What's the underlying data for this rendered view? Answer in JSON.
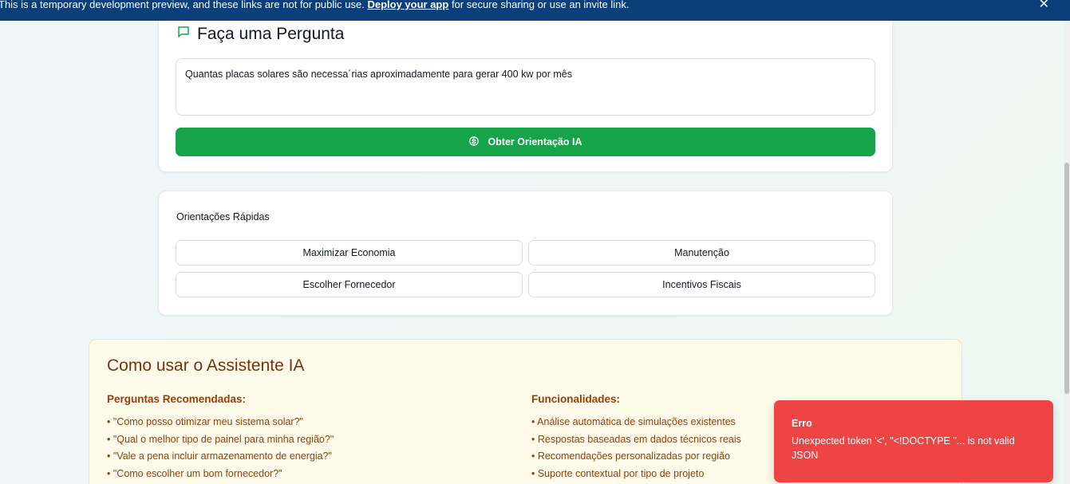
{
  "banner": {
    "text_before": "This is a temporary development preview, and these links are not for public use. ",
    "link_label": "Deploy your app",
    "text_after": " for secure sharing or use an invite link.",
    "close_glyph": "✕"
  },
  "ask": {
    "title": "Faça uma Pergunta",
    "question_value": "Quantas placas solares são necessa´rias aproximadamente para gerar 400 kw por mês",
    "button_label": "Obter Orientação IA",
    "accent": "#16a34a"
  },
  "quick": {
    "title": "Orientações Rápidas",
    "buttons": [
      "Maximizar Economia",
      "Manutenção",
      "Escolher Fornecedor",
      "Incentivos Fiscais"
    ]
  },
  "help": {
    "title": "Como usar o Assistente IA",
    "recommended": {
      "heading": "Perguntas Recomendadas:",
      "items": [
        "• \"Como posso otimizar meu sistema solar?\"",
        "• \"Qual o melhor tipo de painel para minha região?\"",
        "• \"Vale a pena incluir armazenamento de energia?\"",
        "• \"Como escolher um bom fornecedor?\""
      ]
    },
    "features": {
      "heading": "Funcionalidades:",
      "items": [
        "• Análise automática de simulações existentes",
        "• Respostas baseadas em dados técnicos reais",
        "• Recomendações personalizadas por região",
        "• Suporte contextual por tipo de projeto"
      ]
    }
  },
  "toast": {
    "title": "Erro",
    "message": "Unexpected token '<', \"<!DOCTYPE \"... is not valid JSON",
    "color": "#ef4444"
  }
}
